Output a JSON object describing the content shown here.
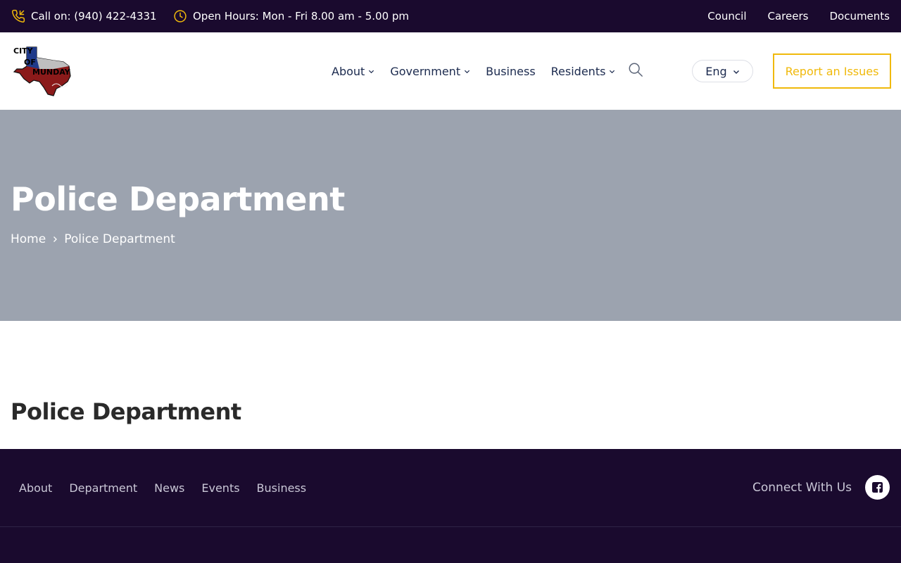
{
  "topbar": {
    "phone_text": "Call on: (940) 422-4331",
    "hours_text": "Open Hours: Mon - Fri 8.00 am - 5.00 pm",
    "links": [
      "Council",
      "Careers",
      "Documents"
    ],
    "icon_color": "#f0b90b"
  },
  "header": {
    "logo_alt": "City of Munday Texas",
    "logo_text": {
      "line1": "CITY",
      "line2": "OF",
      "line3": "MUNDAY"
    },
    "nav": [
      {
        "label": "About",
        "dropdown": true
      },
      {
        "label": "Government",
        "dropdown": true
      },
      {
        "label": "Business",
        "dropdown": false
      },
      {
        "label": "Residents",
        "dropdown": true
      }
    ],
    "language": "Eng",
    "report_button": "Report an Issues",
    "accent_color": "#f0b90b"
  },
  "hero": {
    "title": "Police Department",
    "breadcrumb": {
      "home": "Home",
      "current": "Police Department"
    }
  },
  "content": {
    "title": "Police Department"
  },
  "footer": {
    "nav": [
      "About",
      "Department",
      "News",
      "Events",
      "Business"
    ],
    "connect_label": "Connect With Us",
    "background": "#1a0a2e"
  }
}
